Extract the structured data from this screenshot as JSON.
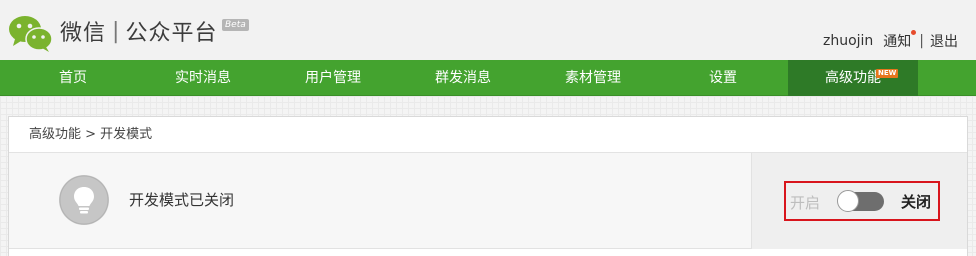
{
  "header": {
    "logo_name": "微信",
    "logo_separator": "|",
    "logo_sub": "公众平台",
    "beta": "Beta",
    "username": "zhuojin",
    "notify_label": "通知",
    "divider": "|",
    "logout_label": "退出"
  },
  "nav": {
    "items": [
      {
        "label": "首页"
      },
      {
        "label": "实时消息"
      },
      {
        "label": "用户管理"
      },
      {
        "label": "群发消息"
      },
      {
        "label": "素材管理"
      },
      {
        "label": "设置"
      },
      {
        "label": "高级功能",
        "badge": "NEW",
        "active": true
      }
    ]
  },
  "breadcrumb": "高级功能 > 开发模式",
  "status": {
    "text": "开发模式已关闭",
    "icon": "lightbulb-icon"
  },
  "switch": {
    "on_label": "开启",
    "off_label": "关闭",
    "state": "off"
  },
  "colors": {
    "nav_green": "#44a32f",
    "nav_active": "#2e7a27",
    "highlight_red": "#d8151c",
    "logo_green": "#7bb32e"
  }
}
